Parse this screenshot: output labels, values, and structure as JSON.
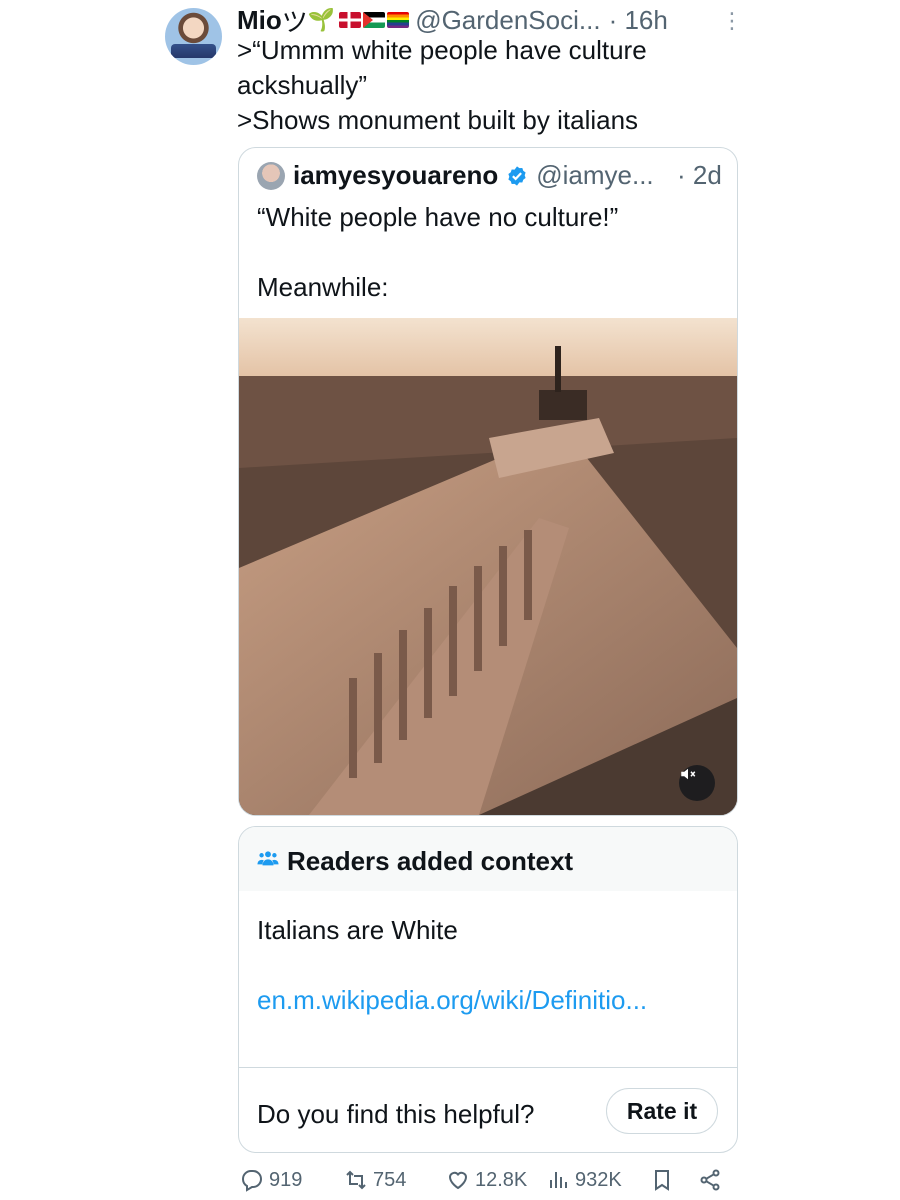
{
  "tweet": {
    "display_name": "Mio",
    "name_suffix": "ツ",
    "handle": "@GardenSoci...",
    "time": "· 16h",
    "body": ">“Ummm white people have culture ackshually”\n>Shows monument built by italians"
  },
  "quote": {
    "display_name": "iamyesyouareno",
    "handle": "@iamye...",
    "time": "· 2d",
    "body": "“White people have no culture!”\n\nMeanwhile:"
  },
  "community_note": {
    "title": "Readers added context",
    "text": "Italians are White",
    "link": "en.m.wikipedia.org/wiki/Definitio...",
    "question": "Do you find this helpful?",
    "rate_button": "Rate it"
  },
  "metrics": {
    "replies": "919",
    "reposts": "754",
    "likes": "12.8K",
    "views": "932K"
  },
  "icons": [
    "sprout-icon",
    "denmark-flag-icon",
    "palestine-flag-icon",
    "pride-flag-icon",
    "more-icon",
    "verified-icon",
    "mute-icon",
    "community-notes-icon",
    "reply-icon",
    "repost-icon",
    "like-icon",
    "views-icon",
    "bookmark-icon",
    "share-icon"
  ],
  "colors": {
    "text": "#0f1419",
    "secondary": "#536471",
    "link": "#1d9bf0",
    "border": "#cfd9de"
  }
}
